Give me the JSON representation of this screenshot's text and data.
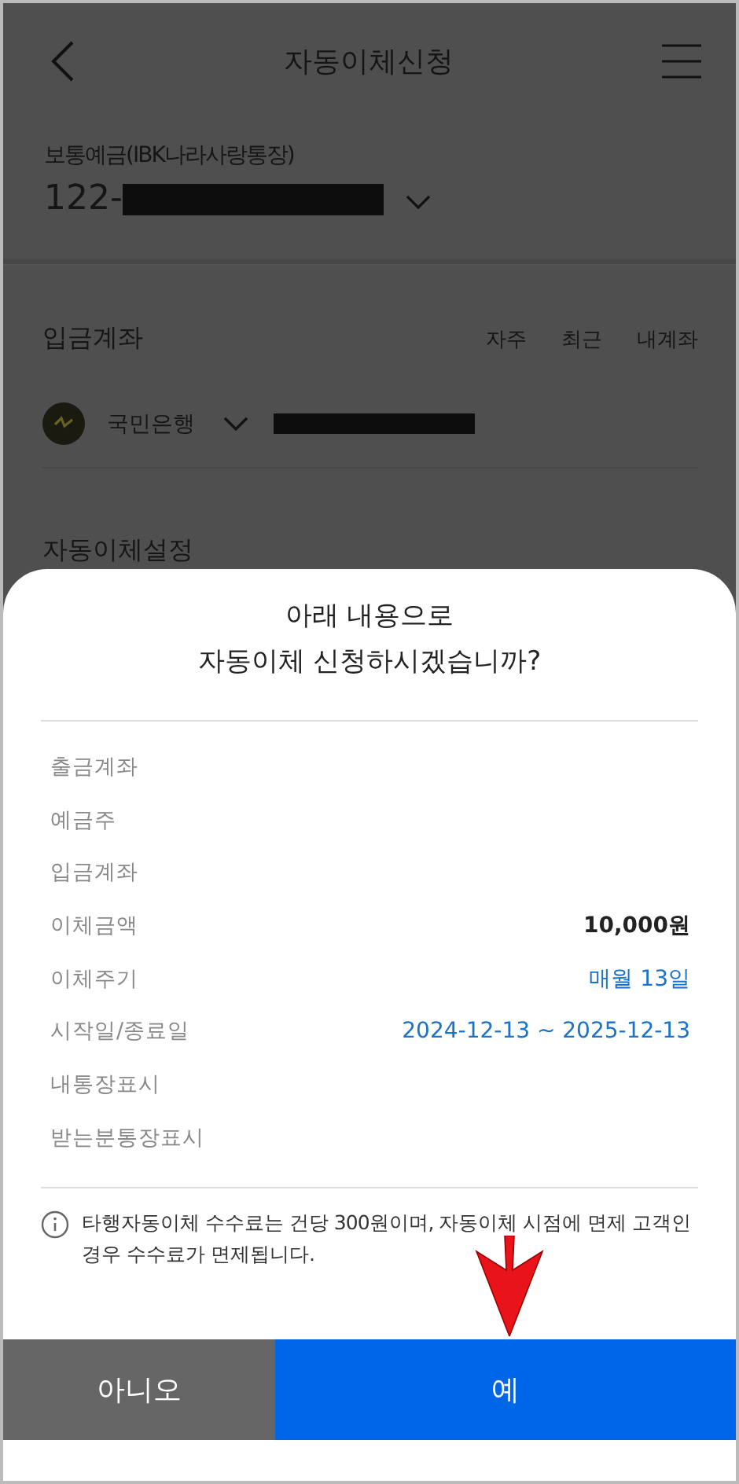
{
  "header": {
    "title": "자동이체신청"
  },
  "withdraw": {
    "label": "보통예금(IBK나라사랑통장)",
    "account": "122-"
  },
  "deposit": {
    "title": "입금계좌",
    "tabs": [
      "자주",
      "최근",
      "내계좌"
    ],
    "bank": "국민은행"
  },
  "section_title": "자동이체설정",
  "dialog": {
    "title_lines": [
      "아래 내용으로",
      "자동이체 신청하시겠습니까?"
    ],
    "rows": [
      {
        "label": "출금계좌"
      },
      {
        "label": "예금주"
      },
      {
        "label": "입금계좌"
      },
      {
        "label": "이체금액",
        "value": "10,000원",
        "kind": "bold"
      },
      {
        "label": "이체주기",
        "value": "매월 13일",
        "kind": "link"
      },
      {
        "label": "시작일/종료일",
        "value": "2024-12-13 ~ 2025-12-13",
        "kind": "link"
      },
      {
        "label": "내통장표시"
      },
      {
        "label": "받는분통장표시"
      }
    ],
    "notice": "타행자동이체 수수료는 건당 300원이며, 자동이체 시점에 면제 고객인 경우 수수료가 면제됩니다.",
    "buttons": [
      {
        "label": "아니오",
        "kind": "cancel"
      },
      {
        "label": "예",
        "kind": "confirm"
      }
    ]
  }
}
